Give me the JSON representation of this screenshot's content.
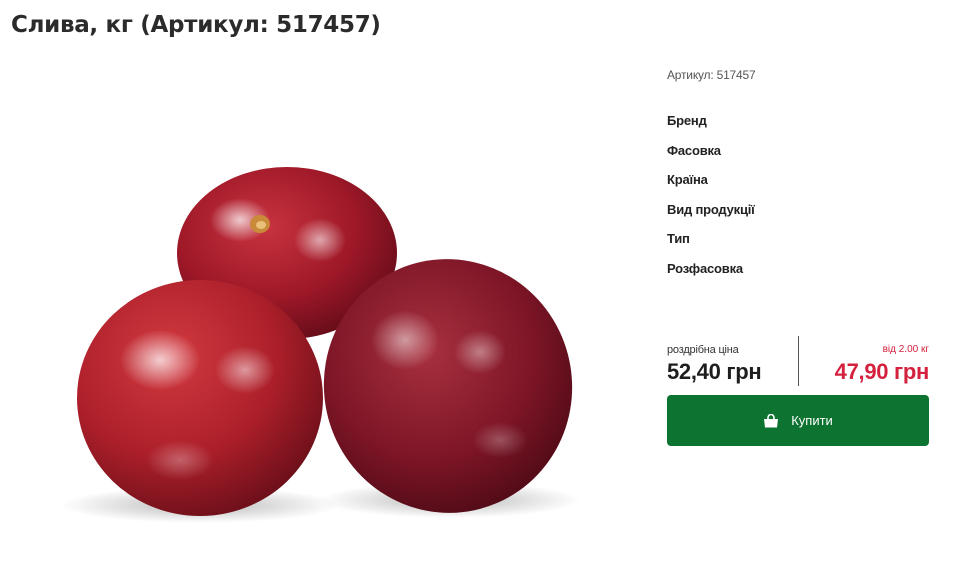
{
  "product": {
    "title": "Слива, кг (Артикул: 517457)",
    "image_alt": "Сливи",
    "sku_line": "Артикул: 517457"
  },
  "attributes": [
    {
      "label": "Бренд"
    },
    {
      "label": "Фасовка"
    },
    {
      "label": "Країна"
    },
    {
      "label": "Вид продукції"
    },
    {
      "label": "Тип"
    },
    {
      "label": "Розфасовка"
    }
  ],
  "pricing": {
    "retail_label": "роздрібна ціна",
    "retail_price": "52,40 грн",
    "bulk_label": "від 2.00 кг",
    "bulk_price": "47,90 грн"
  },
  "actions": {
    "buy_label": "Купити",
    "buy_icon": "shopping-bag-icon"
  },
  "colors": {
    "accent_green": "#0d7330",
    "sale_red": "#d4213d"
  }
}
